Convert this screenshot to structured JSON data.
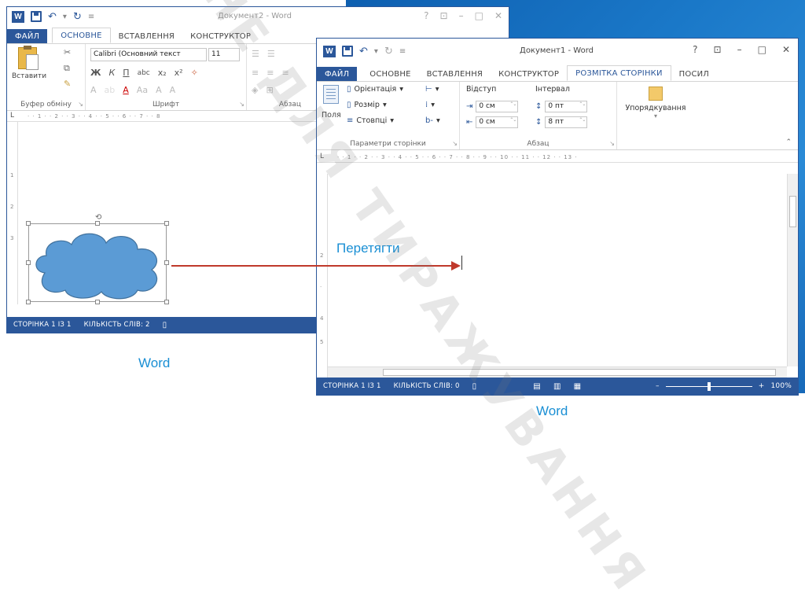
{
  "win1": {
    "title": "Документ2 - Word",
    "app_icon": "W",
    "tabs": [
      "ФАЙЛ",
      "ОСНОВНЕ",
      "ВСТАВЛЕННЯ",
      "КОНСТРУКТОР"
    ],
    "paste_label": "Вставити",
    "font_name": "Calibri (Основний текст",
    "font_size": "11",
    "groups": [
      "Буфер обміну",
      "Шрифт",
      "Абзац"
    ],
    "status": {
      "page": "СТОРІНКА 1 ІЗ 1",
      "words": "КІЛЬКІСТЬ СЛІВ: 2"
    }
  },
  "win2": {
    "title": "Документ1 - Word",
    "app_icon": "W",
    "help": "?",
    "tabs": [
      "ФАЙЛ",
      "ОСНОВНЕ",
      "ВСТАВЛЕННЯ",
      "КОНСТРУКТОР",
      "РОЗМІТКА СТОРІНКИ",
      "ПОСИЛ"
    ],
    "fields_label": "Поля",
    "orientation": "Орієнтація",
    "size": "Розмір",
    "columns": "Стовпці",
    "indent_label": "Відступ",
    "indent_left": "0 см",
    "indent_right": "0 см",
    "spacing_label": "Інтервал",
    "spacing_before": "0 пт",
    "spacing_after": "8 пт",
    "arrange_label": "Упорядкування",
    "groups": [
      "Параметри сторінки",
      "Абзац"
    ],
    "status": {
      "page": "СТОРІНКА 1 ІЗ 1",
      "words": "КІЛЬКІСТЬ СЛІВ: 0",
      "zoom": "100%"
    },
    "zoom_level": 0.5
  },
  "annotations": {
    "drag": "Перетягти",
    "caption_left": "Word",
    "caption_right": "Word"
  },
  "watermark": "НЕ ДЛЯ ТИРАЖУВАННЯ"
}
